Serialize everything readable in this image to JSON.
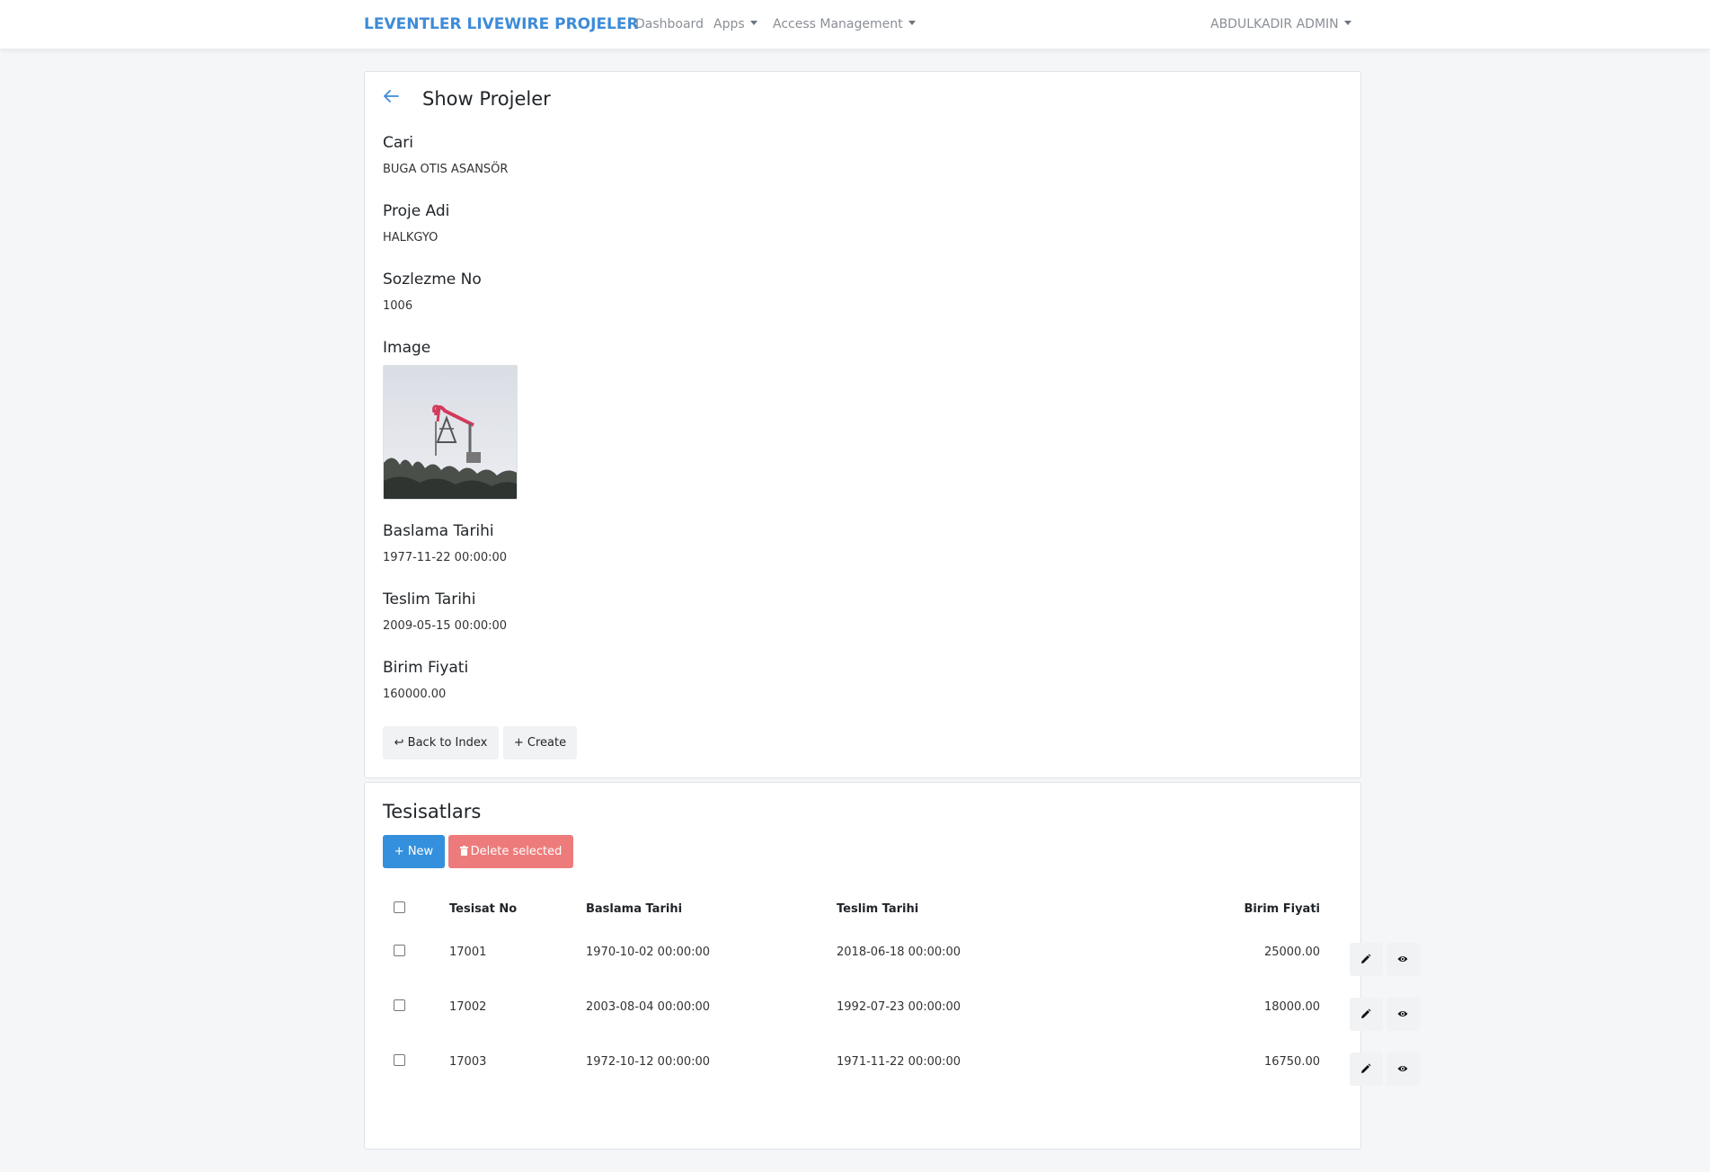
{
  "nav": {
    "brand": "LEVENTLER LIVEWIRE PROJELER",
    "dashboard": "Dashboard",
    "apps": "Apps",
    "access": "Access Management",
    "user": "ABDULKADIR ADMIN"
  },
  "show": {
    "title": "Show Projeler",
    "fields": {
      "cari_label": "Cari",
      "cari_value": "BUGA OTIS ASANSÖR",
      "proje_label": "Proje Adi",
      "proje_value": "HALKGYO",
      "sozlezme_label": "Sozlezme No",
      "sozlezme_value": "1006",
      "image_label": "Image",
      "baslama_label": "Baslama Tarihi",
      "baslama_value": "1977-11-22 00:00:00",
      "teslim_label": "Teslim Tarihi",
      "teslim_value": "2009-05-15 00:00:00",
      "birim_label": "Birim Fiyati",
      "birim_value": "160000.00"
    },
    "back_button": "↩ Back to Index",
    "create_button": "+ Create"
  },
  "tesisat": {
    "title": "Tesisatlars",
    "new_button": "+ New",
    "delete_button": "Delete selected",
    "columns": [
      "Tesisat No",
      "Baslama Tarihi",
      "Teslim Tarihi",
      "Birim Fiyati"
    ],
    "rows": [
      {
        "no": "17001",
        "baslama": "1970-10-02 00:00:00",
        "teslim": "2018-06-18 00:00:00",
        "fiyat": "25000.00"
      },
      {
        "no": "17002",
        "baslama": "2003-08-04 00:00:00",
        "teslim": "1992-07-23 00:00:00",
        "fiyat": "18000.00"
      },
      {
        "no": "17003",
        "baslama": "1972-10-12 00:00:00",
        "teslim": "1971-11-22 00:00:00",
        "fiyat": "16750.00"
      }
    ]
  },
  "icons": {
    "back": "arrow-left-icon",
    "edit": "pencil-icon",
    "view": "eye-icon",
    "delete": "trash-icon"
  },
  "colors": {
    "brand": "#3d8bd9",
    "primary": "#3490dc",
    "danger": "#ee7b7b"
  }
}
